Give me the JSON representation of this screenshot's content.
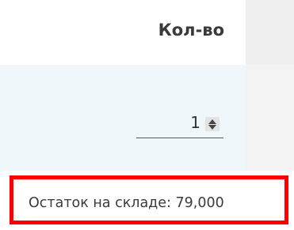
{
  "table": {
    "columns": [
      {
        "label": "Кол-во"
      }
    ],
    "rows": [
      {
        "quantity": "1"
      }
    ]
  },
  "stock_notice": {
    "text": "Остаток на складе: 79,000"
  },
  "colors": {
    "row_background": "#f0f7fa",
    "highlight_border": "#ff0000",
    "text": "#3a3a3a"
  }
}
